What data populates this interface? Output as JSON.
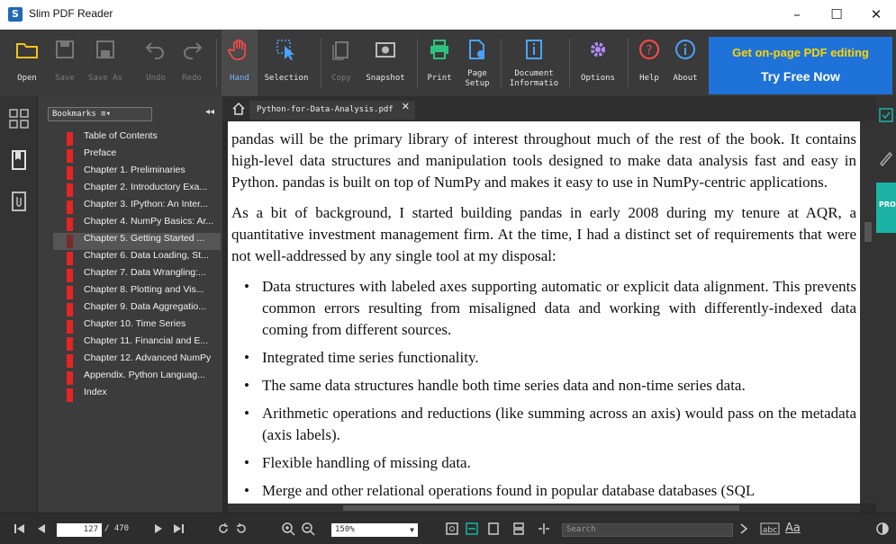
{
  "window": {
    "app_icon_letter": "S",
    "title": "Slim PDF Reader",
    "minimize": "–",
    "maximize": "☐",
    "close": "✕"
  },
  "toolbar": {
    "open": "Open",
    "save": "Save",
    "save_as": "Save As",
    "undo": "Undo",
    "redo": "Redo",
    "hand": "Hand",
    "selection": "Selection",
    "copy": "Copy",
    "snapshot": "Snapshot",
    "print": "Print",
    "page_setup_1": "Page",
    "page_setup_2": "Setup",
    "doc_info_1": "Document",
    "doc_info_2": "Informatio",
    "options": "Options",
    "help": "Help",
    "about": "About"
  },
  "promo": {
    "line1": "Get on-page PDF editing",
    "line2": "Try Free Now"
  },
  "bookmarks": {
    "dropdown": "Bookmarks ≡▾",
    "collapse": "◂◂",
    "items": [
      "Table of Contents",
      "Preface",
      "Chapter 1. Preliminaries",
      "Chapter 2. Introductory Exa...",
      "Chapter 3. IPython: An Inter...",
      "Chapter 4. NumPy Basics: Ar...",
      "Chapter 5. Getting Started ...",
      "Chapter 6. Data Loading, St...",
      "Chapter 7. Data Wrangling:...",
      "Chapter 8. Plotting and Vis...",
      "Chapter 9. Data Aggregatio...",
      "Chapter 10. Time Series",
      "Chapter 11. Financial and E...",
      "Chapter 12. Advanced NumPy",
      "Appendix. Python Languag...",
      "Index"
    ],
    "selected_index": 6
  },
  "document": {
    "tab_name": "Python-for-Data-Analysis.pdf",
    "tab_close": "✕",
    "p1": "pandas will be the primary library of interest throughout much of the rest of the book. It contains high-level data structures and manipulation tools designed to make data analysis fast and easy in Python. pandas is built on top of NumPy and makes it easy to use in NumPy-centric applications.",
    "p2": "As a bit of background, I started building pandas in early 2008 during my tenure at AQR, a quantitative investment management firm. At the time, I had a distinct set of requirements that were not well-addressed by any single tool at my disposal:",
    "bullets": [
      "Data structures with labeled axes supporting automatic or explicit data alignment. This prevents common errors resulting from misaligned data and working with differently-indexed data coming from different sources.",
      "Integrated time series functionality.",
      "The same data structures handle both time series data and non-time series data.",
      "Arithmetic operations and reductions (like summing across an axis) would pass on the metadata (axis labels).",
      "Flexible handling of missing data.",
      "Merge and other relational operations found in popular database databases (SQL"
    ]
  },
  "right_rail": {
    "pro_label": "PRO"
  },
  "status_bar": {
    "current_page": "127",
    "total_pages": "/ 470",
    "zoom": "150%",
    "zoom_arrow": "▼",
    "search_placeholder": "Search",
    "case_label": "Aa"
  },
  "colors": {
    "toolbar_bg": "#3a3a3a",
    "promo_bg": "#1f73d8",
    "promo_yellow": "#ffd400",
    "bookmark_flag": "#e52424",
    "pro_tab": "#1ab3a6"
  }
}
